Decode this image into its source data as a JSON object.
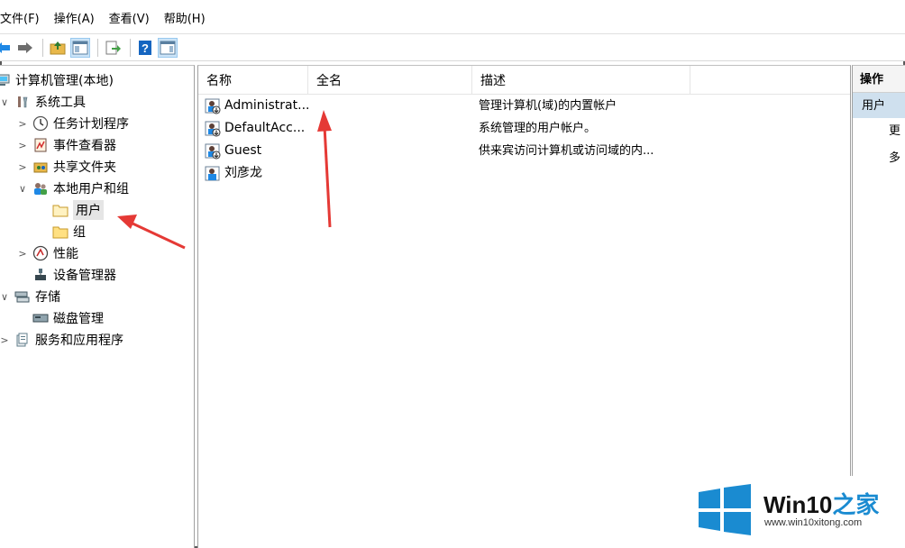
{
  "menu": [
    "文件(F)",
    "操作(A)",
    "查看(V)",
    "帮助(H)"
  ],
  "toolbar": [
    "back-icon",
    "forward-icon",
    "up-folder-icon",
    "show-hide-tree-icon",
    "export-list-icon",
    "help-icon",
    "action-pane-icon"
  ],
  "tree": [
    {
      "label": "计算机管理(本地)",
      "icon": "computer-management-icon",
      "expander": "",
      "level": 0
    },
    {
      "label": "系统工具",
      "icon": "system-tools-icon",
      "expander": "∨",
      "level": 1
    },
    {
      "label": "任务计划程序",
      "icon": "clock-icon",
      "expander": ">",
      "level": 2
    },
    {
      "label": "事件查看器",
      "icon": "event-viewer-icon",
      "expander": ">",
      "level": 2
    },
    {
      "label": "共享文件夹",
      "icon": "shared-folder-icon",
      "expander": ">",
      "level": 2
    },
    {
      "label": "本地用户和组",
      "icon": "users-group-icon",
      "expander": "∨",
      "level": 2
    },
    {
      "label": "用户",
      "icon": "folder-icon",
      "expander": "",
      "level": 3,
      "selected": true
    },
    {
      "label": "组",
      "icon": "folder-icon",
      "expander": "",
      "level": 3
    },
    {
      "label": "性能",
      "icon": "performance-icon",
      "expander": ">",
      "level": 2
    },
    {
      "label": "设备管理器",
      "icon": "device-manager-icon",
      "expander": "",
      "level": 2
    },
    {
      "label": "存储",
      "icon": "storage-icon",
      "expander": "∨",
      "level": 1
    },
    {
      "label": "磁盘管理",
      "icon": "disk-icon",
      "expander": "",
      "level": 2
    },
    {
      "label": "服务和应用程序",
      "icon": "services-icon",
      "expander": ">",
      "level": 1
    }
  ],
  "columns": [
    "名称",
    "全名",
    "描述"
  ],
  "users": [
    {
      "name": "Administrat...",
      "full": "",
      "desc": "管理计算机(域)的内置帐户",
      "disabled": true
    },
    {
      "name": "DefaultAcc...",
      "full": "",
      "desc": "系统管理的用户帐户。",
      "disabled": true
    },
    {
      "name": "Guest",
      "full": "",
      "desc": "供来宾访问计算机或访问域的内...",
      "disabled": true
    },
    {
      "name": "刘彦龙",
      "full": "",
      "desc": "",
      "disabled": false
    }
  ],
  "actions": {
    "title": "操作",
    "section": "用户",
    "more": "更多"
  },
  "watermark": {
    "brand": "Win10",
    "accent": "之家",
    "url": "www.win10xitong.com"
  },
  "colors": {
    "selection": "#cce4f7",
    "annotation_arrow": "#e53935",
    "brand_blue": "#1a8bd1"
  }
}
